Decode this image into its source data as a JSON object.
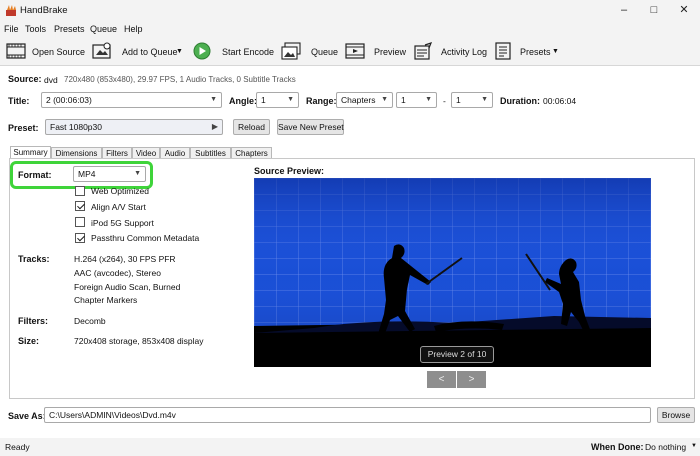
{
  "window": {
    "title": "HandBrake"
  },
  "menu": [
    "File",
    "Tools",
    "Presets",
    "Queue",
    "Help"
  ],
  "toolbar": {
    "open_source": "Open Source",
    "add_to_queue": "Add to Queue",
    "start_encode": "Start Encode",
    "queue": "Queue",
    "preview": "Preview",
    "activity_log": "Activity Log",
    "presets": "Presets"
  },
  "source": {
    "label": "Source:",
    "name": "dvd",
    "details": "720x480 (853x480), 29.97 FPS, 1 Audio Tracks, 0 Subtitle Tracks"
  },
  "title_row": {
    "title_label": "Title:",
    "title_value": "2 (00:06:03)",
    "angle_label": "Angle:",
    "angle_value": "1",
    "range_label": "Range:",
    "range_type": "Chapters",
    "range_start": "1",
    "range_sep": "-",
    "range_end": "1",
    "duration_label": "Duration:",
    "duration_value": "00:06:04"
  },
  "preset": {
    "label": "Preset:",
    "value": "Fast 1080p30",
    "reload": "Reload",
    "save_new": "Save New Preset"
  },
  "tabs": [
    "Summary",
    "Dimensions",
    "Filters",
    "Video",
    "Audio",
    "Subtitles",
    "Chapters"
  ],
  "summary": {
    "format_label": "Format:",
    "format_value": "MP4",
    "options": [
      {
        "label": "Web Optimized",
        "checked": false
      },
      {
        "label": "Align A/V Start",
        "checked": true
      },
      {
        "label": "iPod 5G Support",
        "checked": false
      },
      {
        "label": "Passthru Common Metadata",
        "checked": true
      }
    ],
    "tracks_label": "Tracks:",
    "tracks": [
      "H.264 (x264), 30 FPS PFR",
      "AAC (avcodec), Stereo",
      "Foreign Audio Scan, Burned",
      "Chapter Markers"
    ],
    "filters_label": "Filters:",
    "filters_value": "Decomb",
    "size_label": "Size:",
    "size_value": "720x408 storage, 853x408 display",
    "source_preview_label": "Source Preview:",
    "preview_badge": "Preview 2 of 10",
    "prev": "<",
    "next": ">"
  },
  "save_as": {
    "label": "Save As:",
    "path": "C:\\Users\\ADMIN\\Videos\\Dvd.m4v",
    "browse": "Browse"
  },
  "status": {
    "text": "Ready",
    "when_done_label": "When Done:",
    "when_done_value": "Do nothing"
  }
}
